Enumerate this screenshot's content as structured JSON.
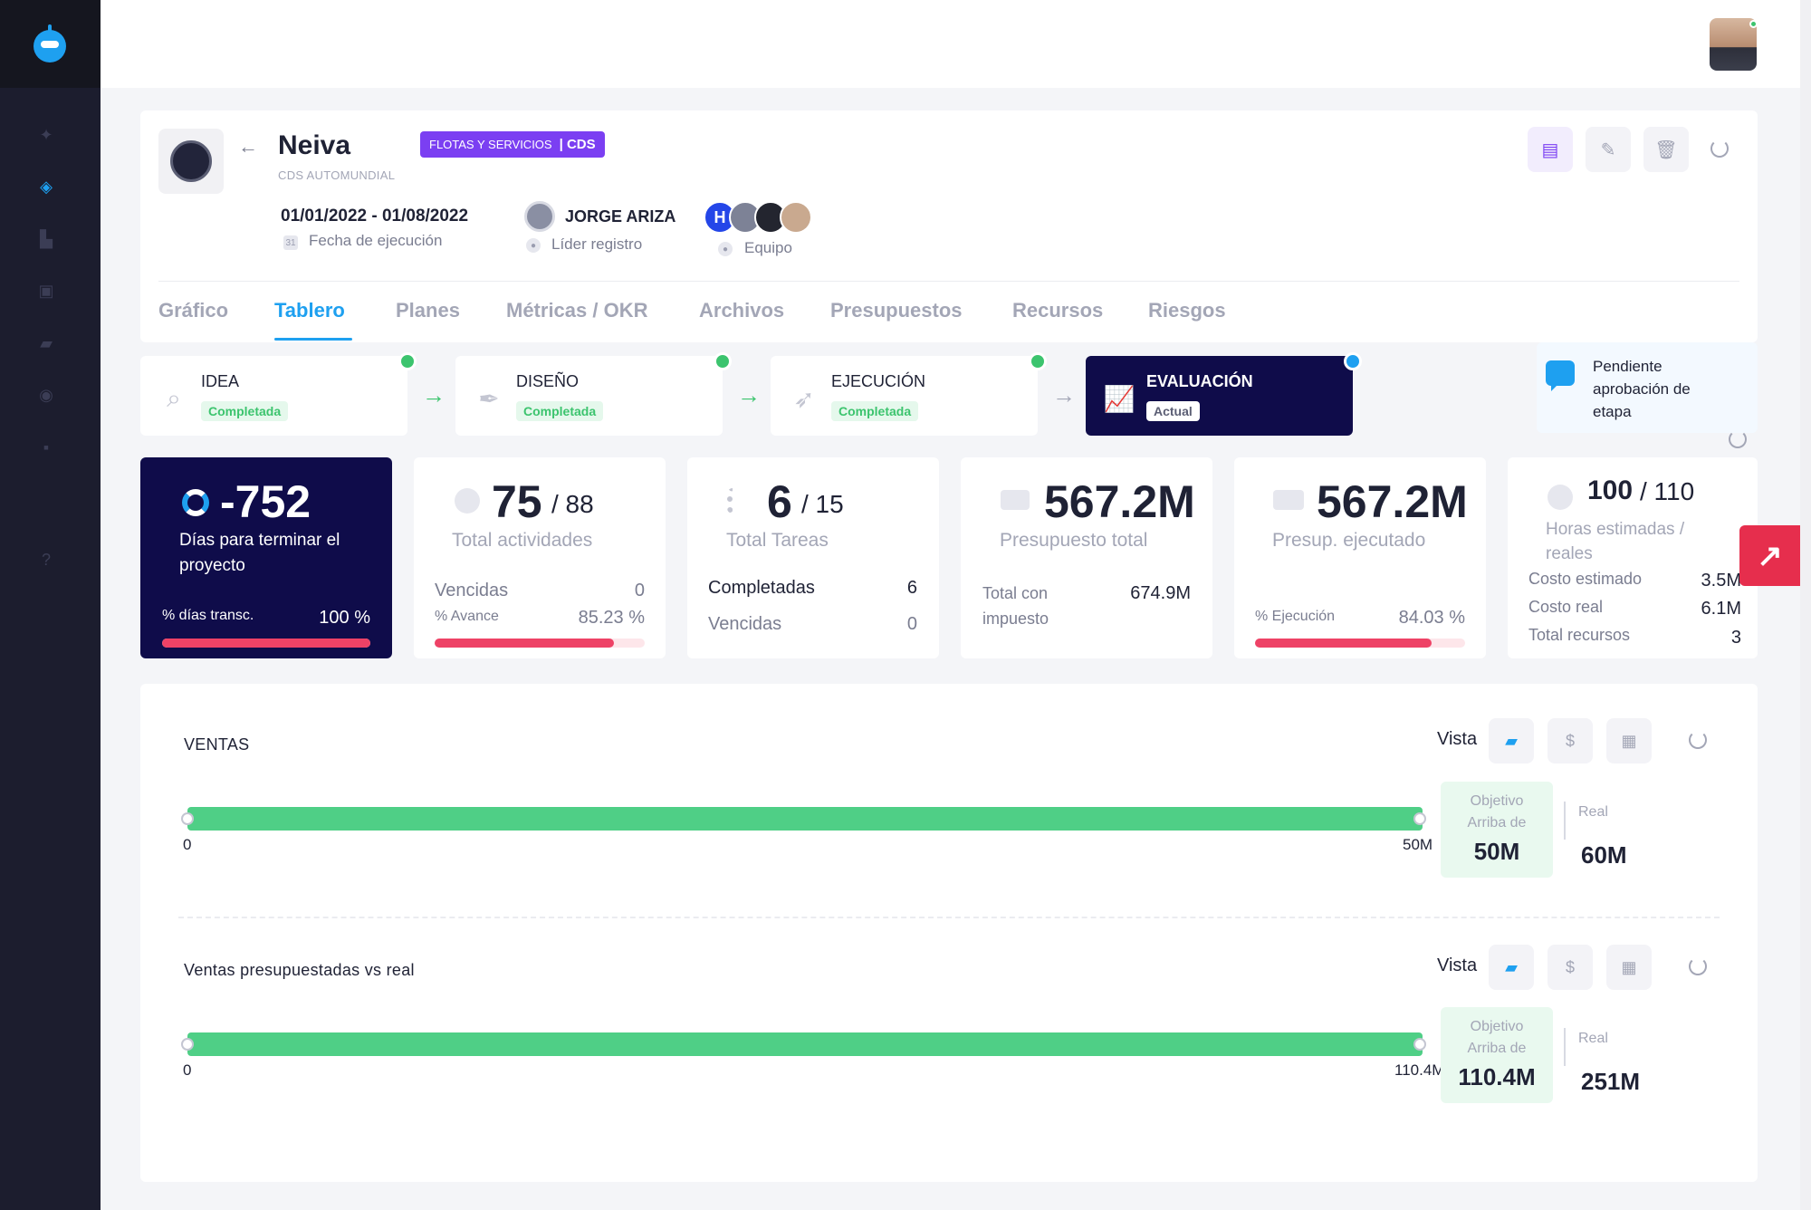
{
  "project": {
    "title": "Neiva",
    "subtitle": "CDS AUTOMUNDIAL",
    "tag": {
      "label": "FLOTAS Y SERVICIOS",
      "code": "| CDS"
    },
    "dates": "01/01/2022 - 01/08/2022",
    "dates_label": "Fecha de ejecución",
    "leader_name": "JORGE ARIZA",
    "leader_label": "Líder registro",
    "team_label": "Equipo",
    "team_initial": "H"
  },
  "tabs": [
    "Gráfico",
    "Tablero",
    "Planes",
    "Métricas / OKR",
    "Archivos",
    "Presupuestos",
    "Recursos",
    "Riesgos"
  ],
  "active_tab": "Tablero",
  "stages": [
    {
      "name": "IDEA",
      "status": "Completada"
    },
    {
      "name": "DISEÑO",
      "status": "Completada"
    },
    {
      "name": "EJECUCIÓN",
      "status": "Completada"
    },
    {
      "name": "EVALUACIÓN",
      "status": "Actual"
    }
  ],
  "pending_text": "Pendiente aprobación de etapa",
  "kpis": {
    "days": {
      "value": "-752",
      "caption": "Días para terminar el proyecto",
      "progress_label": "% días transc.",
      "progress_value": "100 %",
      "progress_fraction": 1.0
    },
    "activities": {
      "value": "75",
      "total": "/ 88",
      "caption": "Total actividades",
      "overdue_label": "Vencidas",
      "overdue_value": "0",
      "advance_label": "% Avance",
      "advance_value": "85.23 %",
      "advance_fraction": 0.8523
    },
    "tasks": {
      "value": "6",
      "total": "/ 15",
      "caption": "Total Tareas",
      "completed_label": "Completadas",
      "completed_value": "6",
      "overdue_label": "Vencidas",
      "overdue_value": "0"
    },
    "budget": {
      "value": "567.2M",
      "caption": "Presupuesto total",
      "tax_label": "Total con impuesto",
      "tax_value": "674.9M"
    },
    "executed": {
      "value": "567.2M",
      "caption": "Presup. ejecutado",
      "exec_label": "% Ejecución",
      "exec_value": "84.03 %",
      "exec_fraction": 0.8403
    },
    "hours": {
      "value": "100",
      "total": "/ 110",
      "caption": "Horas estimadas / reales",
      "est_cost_label": "Costo estimado",
      "est_cost_value": "3.5M",
      "real_cost_label": "Costo real",
      "real_cost_value": "6.1M",
      "resources_label": "Total recursos",
      "resources_value": "3"
    }
  },
  "sales": [
    {
      "title": "VENTAS",
      "vista_label": "Vista",
      "min": "0",
      "max": "50M",
      "objective_label": "Objetivo Arriba de",
      "objective_value": "50M",
      "real_label": "Real",
      "real_value": "60M"
    },
    {
      "title": "Ventas presupuestadas vs real",
      "vista_label": "Vista",
      "min": "0",
      "max": "110.4M",
      "objective_label": "Objetivo Arriba de",
      "objective_value": "110.4M",
      "real_label": "Real",
      "real_value": "251M"
    }
  ],
  "icons": {
    "vista_toggle": "wallet-icon",
    "vista_currency": "$",
    "vista_calc": "calculator-icon"
  },
  "colors": {
    "accent": "#1ea0f0",
    "dark": "#0f0c4a",
    "success": "#3cc46e",
    "danger": "#ee4266",
    "tag": "#7b3ff2"
  }
}
